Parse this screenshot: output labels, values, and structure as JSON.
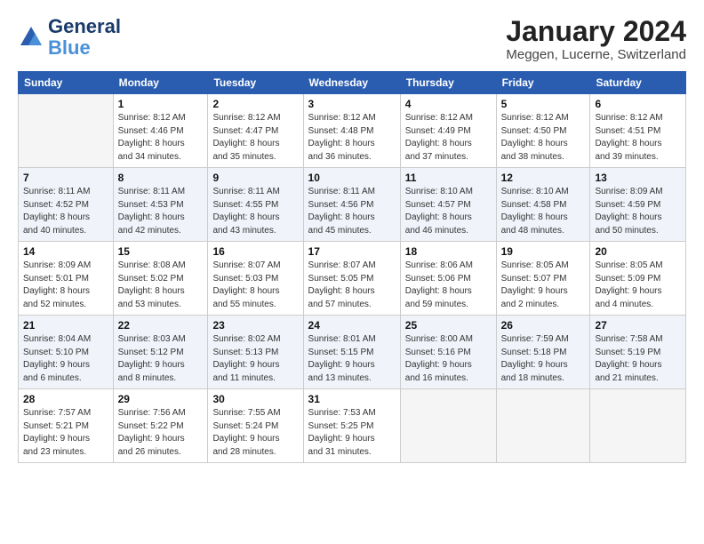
{
  "logo": {
    "line1": "General",
    "line2": "Blue"
  },
  "title": "January 2024",
  "subtitle": "Meggen, Lucerne, Switzerland",
  "days_of_week": [
    "Sunday",
    "Monday",
    "Tuesday",
    "Wednesday",
    "Thursday",
    "Friday",
    "Saturday"
  ],
  "weeks": [
    [
      {
        "num": "",
        "info": ""
      },
      {
        "num": "1",
        "info": "Sunrise: 8:12 AM\nSunset: 4:46 PM\nDaylight: 8 hours\nand 34 minutes."
      },
      {
        "num": "2",
        "info": "Sunrise: 8:12 AM\nSunset: 4:47 PM\nDaylight: 8 hours\nand 35 minutes."
      },
      {
        "num": "3",
        "info": "Sunrise: 8:12 AM\nSunset: 4:48 PM\nDaylight: 8 hours\nand 36 minutes."
      },
      {
        "num": "4",
        "info": "Sunrise: 8:12 AM\nSunset: 4:49 PM\nDaylight: 8 hours\nand 37 minutes."
      },
      {
        "num": "5",
        "info": "Sunrise: 8:12 AM\nSunset: 4:50 PM\nDaylight: 8 hours\nand 38 minutes."
      },
      {
        "num": "6",
        "info": "Sunrise: 8:12 AM\nSunset: 4:51 PM\nDaylight: 8 hours\nand 39 minutes."
      }
    ],
    [
      {
        "num": "7",
        "info": "Sunrise: 8:11 AM\nSunset: 4:52 PM\nDaylight: 8 hours\nand 40 minutes."
      },
      {
        "num": "8",
        "info": "Sunrise: 8:11 AM\nSunset: 4:53 PM\nDaylight: 8 hours\nand 42 minutes."
      },
      {
        "num": "9",
        "info": "Sunrise: 8:11 AM\nSunset: 4:55 PM\nDaylight: 8 hours\nand 43 minutes."
      },
      {
        "num": "10",
        "info": "Sunrise: 8:11 AM\nSunset: 4:56 PM\nDaylight: 8 hours\nand 45 minutes."
      },
      {
        "num": "11",
        "info": "Sunrise: 8:10 AM\nSunset: 4:57 PM\nDaylight: 8 hours\nand 46 minutes."
      },
      {
        "num": "12",
        "info": "Sunrise: 8:10 AM\nSunset: 4:58 PM\nDaylight: 8 hours\nand 48 minutes."
      },
      {
        "num": "13",
        "info": "Sunrise: 8:09 AM\nSunset: 4:59 PM\nDaylight: 8 hours\nand 50 minutes."
      }
    ],
    [
      {
        "num": "14",
        "info": "Sunrise: 8:09 AM\nSunset: 5:01 PM\nDaylight: 8 hours\nand 52 minutes."
      },
      {
        "num": "15",
        "info": "Sunrise: 8:08 AM\nSunset: 5:02 PM\nDaylight: 8 hours\nand 53 minutes."
      },
      {
        "num": "16",
        "info": "Sunrise: 8:07 AM\nSunset: 5:03 PM\nDaylight: 8 hours\nand 55 minutes."
      },
      {
        "num": "17",
        "info": "Sunrise: 8:07 AM\nSunset: 5:05 PM\nDaylight: 8 hours\nand 57 minutes."
      },
      {
        "num": "18",
        "info": "Sunrise: 8:06 AM\nSunset: 5:06 PM\nDaylight: 8 hours\nand 59 minutes."
      },
      {
        "num": "19",
        "info": "Sunrise: 8:05 AM\nSunset: 5:07 PM\nDaylight: 9 hours\nand 2 minutes."
      },
      {
        "num": "20",
        "info": "Sunrise: 8:05 AM\nSunset: 5:09 PM\nDaylight: 9 hours\nand 4 minutes."
      }
    ],
    [
      {
        "num": "21",
        "info": "Sunrise: 8:04 AM\nSunset: 5:10 PM\nDaylight: 9 hours\nand 6 minutes."
      },
      {
        "num": "22",
        "info": "Sunrise: 8:03 AM\nSunset: 5:12 PM\nDaylight: 9 hours\nand 8 minutes."
      },
      {
        "num": "23",
        "info": "Sunrise: 8:02 AM\nSunset: 5:13 PM\nDaylight: 9 hours\nand 11 minutes."
      },
      {
        "num": "24",
        "info": "Sunrise: 8:01 AM\nSunset: 5:15 PM\nDaylight: 9 hours\nand 13 minutes."
      },
      {
        "num": "25",
        "info": "Sunrise: 8:00 AM\nSunset: 5:16 PM\nDaylight: 9 hours\nand 16 minutes."
      },
      {
        "num": "26",
        "info": "Sunrise: 7:59 AM\nSunset: 5:18 PM\nDaylight: 9 hours\nand 18 minutes."
      },
      {
        "num": "27",
        "info": "Sunrise: 7:58 AM\nSunset: 5:19 PM\nDaylight: 9 hours\nand 21 minutes."
      }
    ],
    [
      {
        "num": "28",
        "info": "Sunrise: 7:57 AM\nSunset: 5:21 PM\nDaylight: 9 hours\nand 23 minutes."
      },
      {
        "num": "29",
        "info": "Sunrise: 7:56 AM\nSunset: 5:22 PM\nDaylight: 9 hours\nand 26 minutes."
      },
      {
        "num": "30",
        "info": "Sunrise: 7:55 AM\nSunset: 5:24 PM\nDaylight: 9 hours\nand 28 minutes."
      },
      {
        "num": "31",
        "info": "Sunrise: 7:53 AM\nSunset: 5:25 PM\nDaylight: 9 hours\nand 31 minutes."
      },
      {
        "num": "",
        "info": ""
      },
      {
        "num": "",
        "info": ""
      },
      {
        "num": "",
        "info": ""
      }
    ]
  ]
}
